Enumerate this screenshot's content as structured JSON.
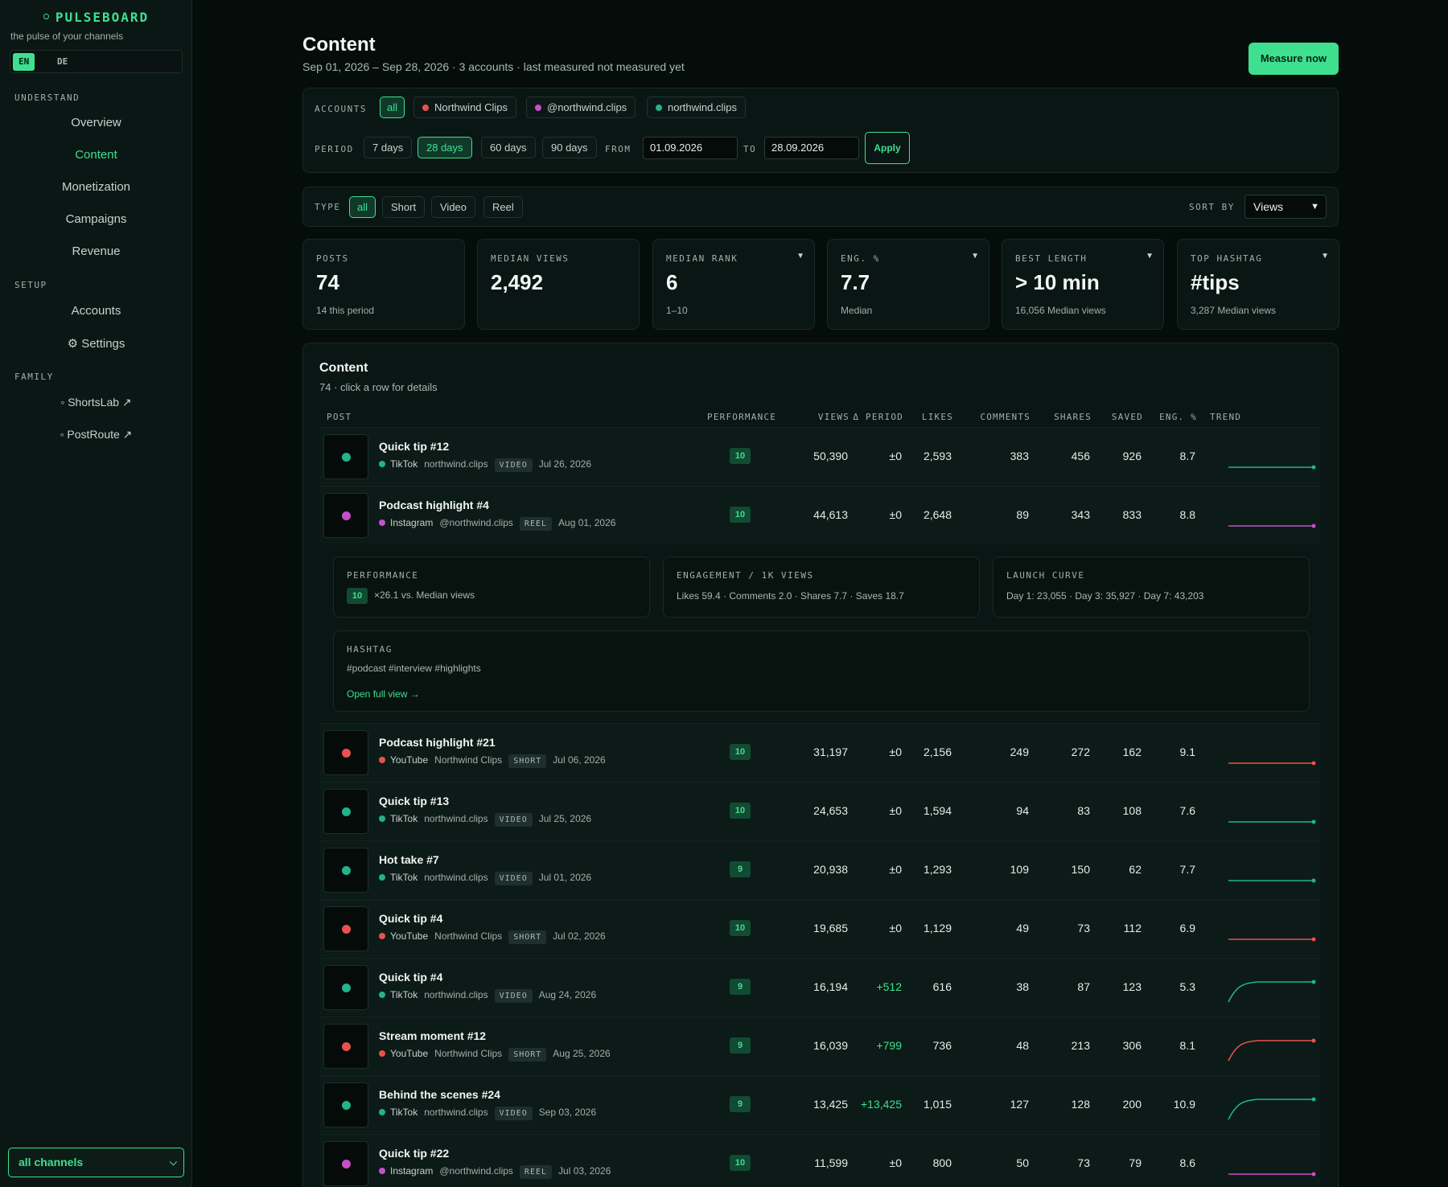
{
  "sidebar": {
    "brand": "PULSEBOARD",
    "tagline": "the pulse of your channels",
    "lang": {
      "en": "EN",
      "de": "DE"
    },
    "sections": {
      "understand": "UNDERSTAND",
      "setup": "SETUP",
      "family": "FAMILY"
    },
    "understand_items": [
      "Overview",
      "Content",
      "Monetization",
      "Campaigns",
      "Revenue"
    ],
    "setup_items": [
      "Accounts",
      "⚙ Settings"
    ],
    "family_items": [
      "◦ ShortsLab ↗",
      "◦ PostRoute ↗"
    ],
    "channel_select": "all channels"
  },
  "header": {
    "title": "Content",
    "subtitle": "Sep 01, 2026 – Sep 28, 2026 · 3 accounts · last measured not measured yet",
    "measure_button": "Measure now"
  },
  "filters": {
    "accounts_label": "ACCOUNTS",
    "accounts": [
      {
        "label": "all",
        "active": true
      },
      {
        "label": "Northwind Clips",
        "color": "#e8524d"
      },
      {
        "label": "@northwind.clips",
        "color": "#c64fc6"
      },
      {
        "label": "northwind.clips",
        "color": "#22b38a"
      }
    ],
    "period_label": "PERIOD",
    "periods": [
      {
        "label": "7 days"
      },
      {
        "label": "28 days",
        "active": true
      },
      {
        "label": "60 days"
      },
      {
        "label": "90 days"
      }
    ],
    "from_label": "FROM",
    "from_value": "01.09.2026",
    "to_label": "TO",
    "to_value": "28.09.2026",
    "apply": "Apply",
    "type_label": "TYPE",
    "types": [
      {
        "label": "all",
        "active": true
      },
      {
        "label": "Short"
      },
      {
        "label": "Video"
      },
      {
        "label": "Reel"
      }
    ],
    "sort_label": "SORT BY",
    "sort_value": "Views"
  },
  "kpis": [
    {
      "label": "POSTS",
      "value": "74",
      "note": "14 this period",
      "dropdown": false
    },
    {
      "label": "MEDIAN VIEWS",
      "value": "2,492",
      "note": "",
      "dropdown": false
    },
    {
      "label": "MEDIAN RANK",
      "value": "6",
      "note": "1–10",
      "dropdown": true
    },
    {
      "label": "ENG. %",
      "value": "7.7",
      "note": "Median",
      "dropdown": true
    },
    {
      "label": "BEST LENGTH",
      "value": "> 10 min",
      "note": "16,056 Median views",
      "dropdown": true
    },
    {
      "label": "TOP HASHTAG",
      "value": "#tips",
      "note": "3,287 Median views",
      "dropdown": true
    }
  ],
  "table": {
    "title": "Content",
    "subtitle": "74 · click a row for details",
    "headers": {
      "post": "POST",
      "performance": "PERFORMANCE",
      "views": "VIEWS",
      "delta": "Δ PERIOD",
      "likes": "LIKES",
      "comments": "COMMENTS",
      "shares": "SHARES",
      "saved": "SAVED",
      "eng": "ENG. %",
      "trend": "TREND"
    },
    "rows": [
      {
        "title": "Quick tip #12",
        "platform": "TikTok",
        "account": "northwind.clips",
        "type": "VIDEO",
        "date": "Jul 26, 2026",
        "color": "#22b38a",
        "perf": "10",
        "views": "50,390",
        "delta": "±0",
        "likes": "2,593",
        "comments": "383",
        "shares": "456",
        "saved": "926",
        "eng": "8.7",
        "trend": "flat"
      },
      {
        "title": "Podcast highlight #4",
        "platform": "Instagram",
        "account": "@northwind.clips",
        "type": "REEL",
        "date": "Aug 01, 2026",
        "color": "#c64fc6",
        "perf": "10",
        "views": "44,613",
        "delta": "±0",
        "likes": "2,648",
        "comments": "89",
        "shares": "343",
        "saved": "833",
        "eng": "8.8",
        "trend": "flat"
      },
      {
        "title": "Podcast highlight #21",
        "platform": "YouTube",
        "account": "Northwind Clips",
        "type": "SHORT",
        "date": "Jul 06, 2026",
        "color": "#e8524d",
        "perf": "10",
        "views": "31,197",
        "delta": "±0",
        "likes": "2,156",
        "comments": "249",
        "shares": "272",
        "saved": "162",
        "eng": "9.1",
        "trend": "flat"
      },
      {
        "title": "Quick tip #13",
        "platform": "TikTok",
        "account": "northwind.clips",
        "type": "VIDEO",
        "date": "Jul 25, 2026",
        "color": "#22b38a",
        "perf": "10",
        "views": "24,653",
        "delta": "±0",
        "likes": "1,594",
        "comments": "94",
        "shares": "83",
        "saved": "108",
        "eng": "7.6",
        "trend": "flat"
      },
      {
        "title": "Hot take #7",
        "platform": "TikTok",
        "account": "northwind.clips",
        "type": "VIDEO",
        "date": "Jul 01, 2026",
        "color": "#22b38a",
        "perf": "9",
        "views": "20,938",
        "delta": "±0",
        "likes": "1,293",
        "comments": "109",
        "shares": "150",
        "saved": "62",
        "eng": "7.7",
        "trend": "flat"
      },
      {
        "title": "Quick tip #4",
        "platform": "YouTube",
        "account": "Northwind Clips",
        "type": "SHORT",
        "date": "Jul 02, 2026",
        "color": "#e8524d",
        "perf": "10",
        "views": "19,685",
        "delta": "±0",
        "likes": "1,129",
        "comments": "49",
        "shares": "73",
        "saved": "112",
        "eng": "6.9",
        "trend": "flat"
      },
      {
        "title": "Quick tip #4",
        "platform": "TikTok",
        "account": "northwind.clips",
        "type": "VIDEO",
        "date": "Aug 24, 2026",
        "color": "#22b38a",
        "perf": "9",
        "views": "16,194",
        "delta": "+512",
        "likes": "616",
        "comments": "38",
        "shares": "87",
        "saved": "123",
        "eng": "5.3",
        "trend": "rise"
      },
      {
        "title": "Stream moment #12",
        "platform": "YouTube",
        "account": "Northwind Clips",
        "type": "SHORT",
        "date": "Aug 25, 2026",
        "color": "#e8524d",
        "perf": "9",
        "views": "16,039",
        "delta": "+799",
        "likes": "736",
        "comments": "48",
        "shares": "213",
        "saved": "306",
        "eng": "8.1",
        "trend": "rise"
      },
      {
        "title": "Behind the scenes #24",
        "platform": "TikTok",
        "account": "northwind.clips",
        "type": "VIDEO",
        "date": "Sep 03, 2026",
        "color": "#22b38a",
        "perf": "9",
        "views": "13,425",
        "delta": "+13,425",
        "likes": "1,015",
        "comments": "127",
        "shares": "128",
        "saved": "200",
        "eng": "10.9",
        "trend": "rise"
      },
      {
        "title": "Quick tip #22",
        "platform": "Instagram",
        "account": "@northwind.clips",
        "type": "REEL",
        "date": "Jul 03, 2026",
        "color": "#c64fc6",
        "perf": "10",
        "views": "11,599",
        "delta": "±0",
        "likes": "800",
        "comments": "50",
        "shares": "73",
        "saved": "79",
        "eng": "8.6",
        "trend": "flat"
      }
    ]
  },
  "detail": {
    "performance_label": "PERFORMANCE",
    "performance_badge": "10",
    "performance_text": "×26.1 vs. Median views",
    "engagement_label": "ENGAGEMENT / 1K VIEWS",
    "engagement_text": "Likes 59.4 · Comments 2.0 · Shares 7.7 · Saves 18.7",
    "launch_label": "LAUNCH CURVE",
    "launch_text": "Day 1: 23,055 · Day 3: 35,927 · Day 7: 43,203",
    "hashtag_label": "HASHTAG",
    "hashtag_text": "#podcast #interview #highlights",
    "open_link": "Open full view →"
  }
}
